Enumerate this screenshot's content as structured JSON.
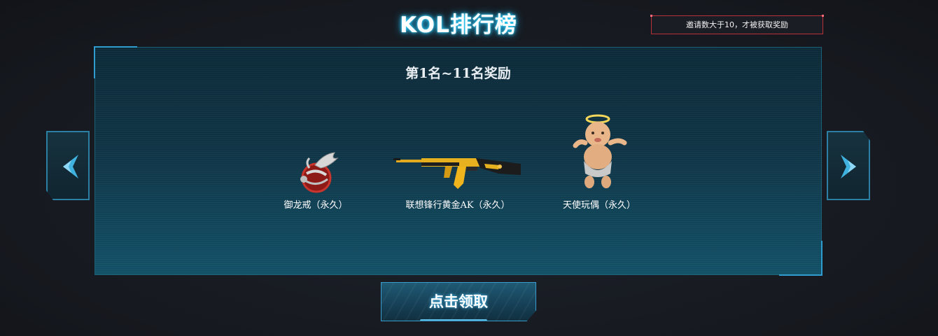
{
  "header": {
    "title": "KOL排行榜"
  },
  "notice": {
    "text": "邀请数大于10，才被获取奖励"
  },
  "panel": {
    "heading": "第1名~11名奖励"
  },
  "rewards": [
    {
      "name": "御龙戒（永久）",
      "icon": "dragon-ring-icon"
    },
    {
      "name": "联想锋行黄金AK（永久）",
      "icon": "golden-ak-rifle-icon"
    },
    {
      "name": "天使玩偶（永久）",
      "icon": "angel-doll-icon"
    }
  ],
  "nav": {
    "prev_icon": "chevron-left-icon",
    "next_icon": "chevron-right-icon"
  },
  "claim_button": {
    "label": "点击领取"
  },
  "colors": {
    "accent": "#2fd4ff",
    "panel": "#0f3445",
    "notice_border": "#b8303a"
  }
}
